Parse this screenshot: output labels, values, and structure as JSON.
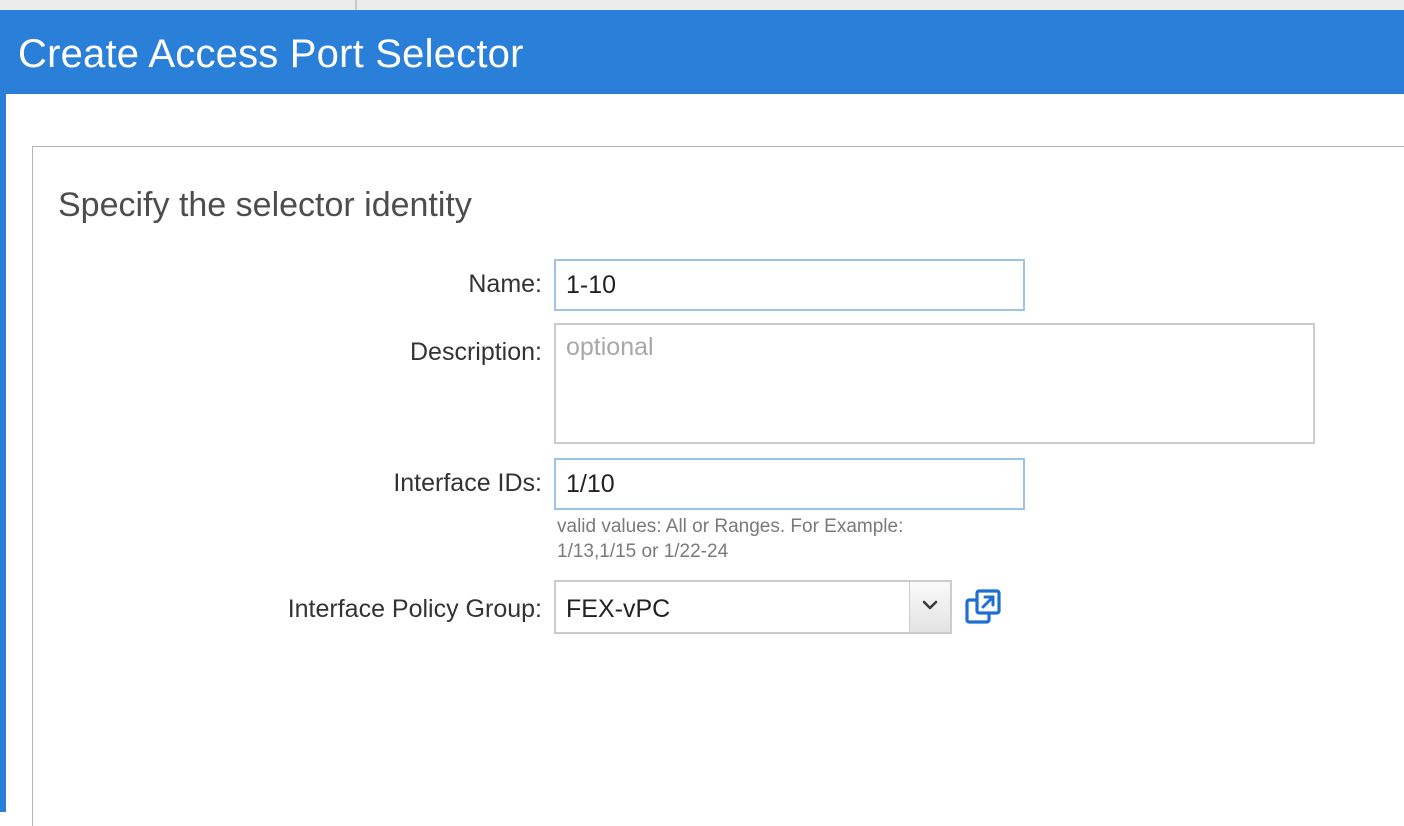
{
  "dialog": {
    "title": "Create Access Port Selector"
  },
  "section": {
    "heading": "Specify the selector identity"
  },
  "form": {
    "name": {
      "label": "Name:",
      "value": "1-10"
    },
    "description": {
      "label": "Description:",
      "placeholder": "optional",
      "value": ""
    },
    "interface_ids": {
      "label": "Interface IDs:",
      "value": "1/10",
      "help_line1": "valid values: All or Ranges. For Example:",
      "help_line2": "1/13,1/15 or 1/22-24"
    },
    "policy_group": {
      "label": "Interface Policy Group:",
      "selected": "FEX-vPC"
    }
  },
  "icons": {
    "dropdown": "chevron-down-icon",
    "popout": "open-in-new-window-icon"
  },
  "colors": {
    "title_bar": "#2a7fd8",
    "input_focus_border": "#9fc3e8",
    "icon_blue": "#1f6fd0"
  }
}
